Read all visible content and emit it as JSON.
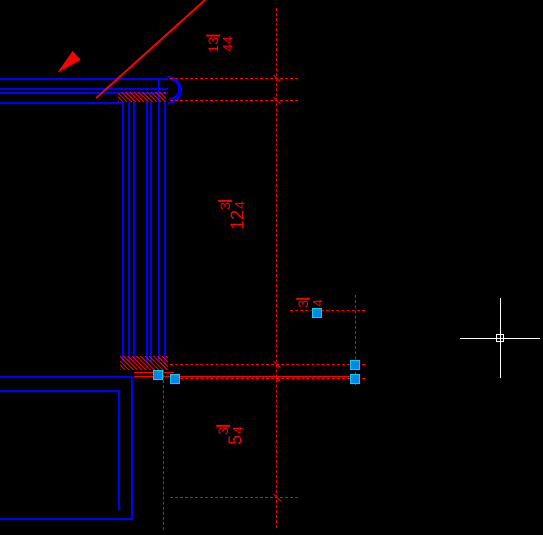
{
  "dimensions": {
    "top_offset": {
      "whole": "",
      "num": "13",
      "den": "44"
    },
    "mid_height": {
      "whole": "12",
      "num": "3",
      "den": "4"
    },
    "bot_height": {
      "whole": "5",
      "num": "3",
      "den": "4"
    },
    "small_right": {
      "whole": "",
      "num": "3",
      "den": "4"
    }
  },
  "colors": {
    "geometry": "#0000ff",
    "dimension": "#ff0000",
    "grip": "#0088dd",
    "bg": "#000000"
  },
  "chart_data": null
}
